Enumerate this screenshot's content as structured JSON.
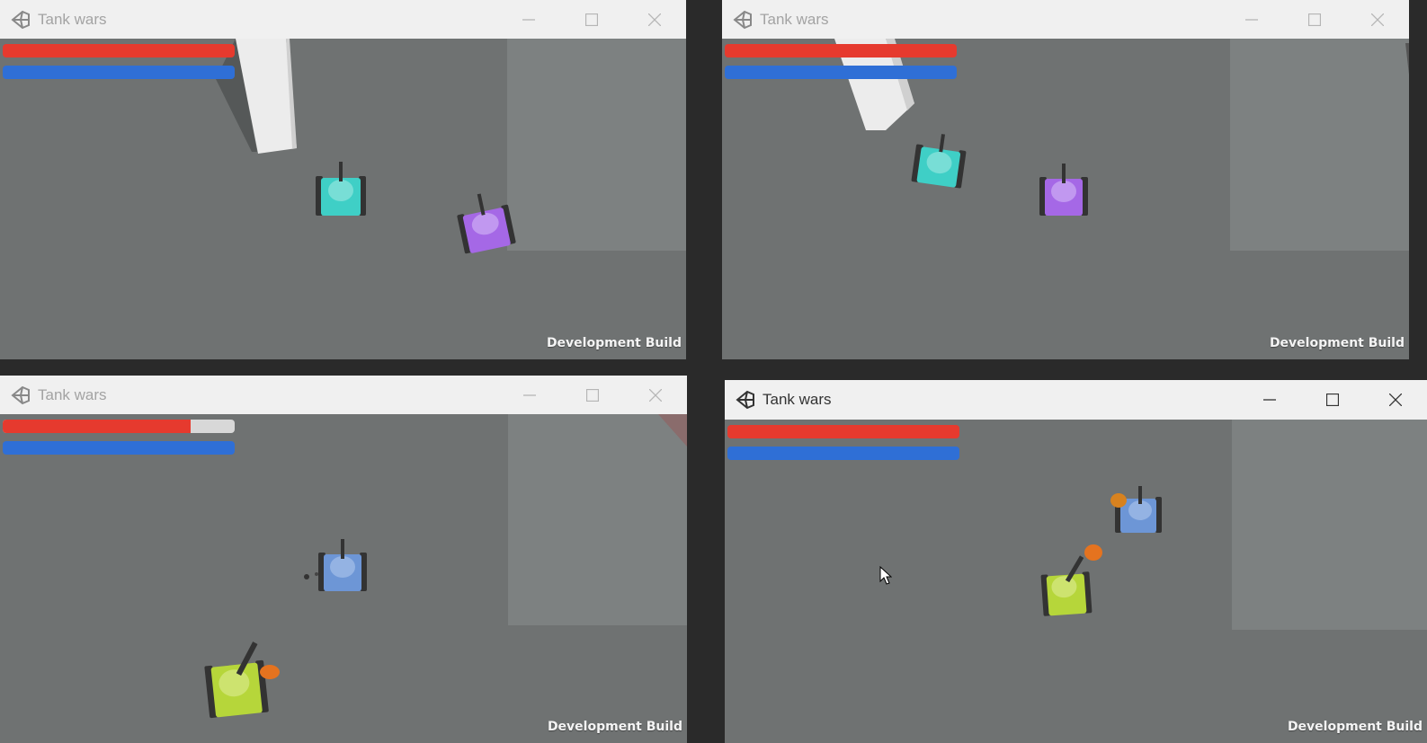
{
  "windows": [
    {
      "title": "Tank wars",
      "overlay": "Development Build",
      "health": 1.0,
      "ammo": 1.0
    },
    {
      "title": "Tank wars",
      "overlay": "Development Build",
      "health": 1.0,
      "ammo": 1.0
    },
    {
      "title": "Tank wars",
      "overlay": "Development Build",
      "health": 0.81,
      "ammo": 1.0
    },
    {
      "title": "Tank wars",
      "overlay": "Development Build",
      "health": 1.0,
      "ammo": 1.0
    }
  ],
  "icons": {
    "app": "unity-logo-icon",
    "minimize": "minimize-icon",
    "maximize": "maximize-icon",
    "close": "close-icon",
    "cursor": "mouse-cursor-icon"
  },
  "colors": {
    "health": "#e63a2e",
    "ammo": "#2f6fd6",
    "tank_cyan": "#3fcfc6",
    "tank_purple": "#a568e6",
    "tank_blue": "#6d96d6",
    "tank_green": "#b6d63a",
    "projectile": "#e5731f"
  }
}
